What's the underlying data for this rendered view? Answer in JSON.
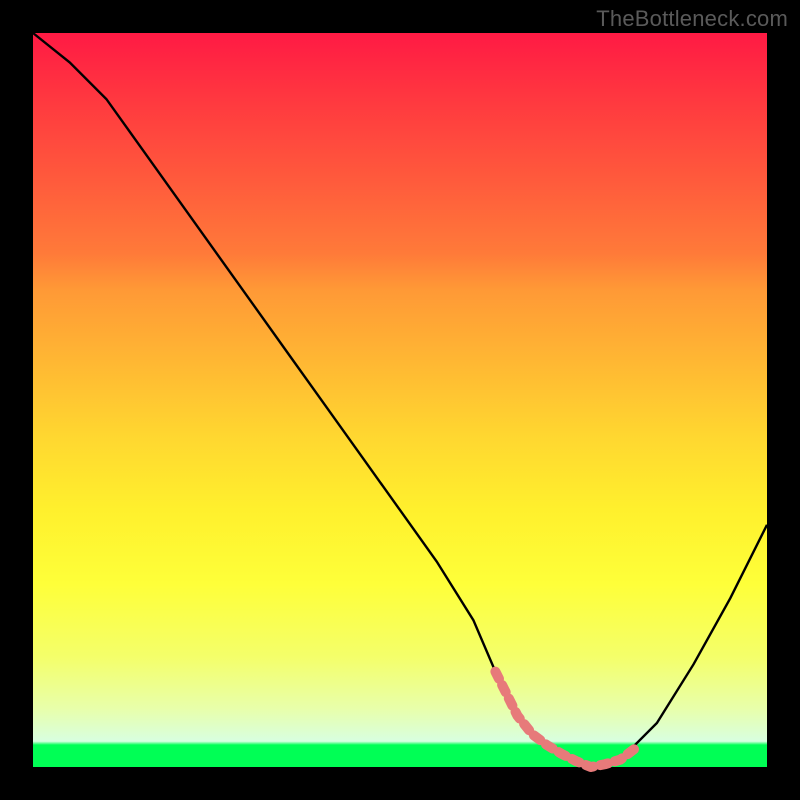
{
  "watermark": "TheBottleneck.com",
  "chart_data": {
    "type": "line",
    "title": "",
    "xlabel": "",
    "ylabel": "",
    "ylim": [
      0,
      100
    ],
    "x": [
      0,
      5,
      10,
      15,
      20,
      25,
      30,
      35,
      40,
      45,
      50,
      55,
      60,
      63,
      66,
      70,
      73,
      76,
      80,
      85,
      90,
      95,
      100
    ],
    "series": [
      {
        "name": "bottleneck-curve",
        "values": [
          100,
          96,
          91,
          84,
          77,
          70,
          63,
          56,
          49,
          42,
          35,
          28,
          20,
          13,
          7,
          3,
          1,
          0,
          1,
          6,
          14,
          23,
          33
        ]
      }
    ],
    "highlight": {
      "name": "optimal-zone",
      "x": [
        63,
        66,
        68,
        70,
        72,
        74,
        76,
        78,
        80,
        82
      ],
      "values": [
        13,
        7,
        4.5,
        3,
        1.8,
        0.8,
        0,
        0.4,
        1,
        2.5
      ],
      "color": "#e77a7a"
    },
    "gradient_stops": [
      {
        "pos": 0,
        "color": "#ff1a44"
      },
      {
        "pos": 50,
        "color": "#ffd730"
      },
      {
        "pos": 80,
        "color": "#feff39"
      },
      {
        "pos": 97,
        "color": "#d8ffe0"
      },
      {
        "pos": 100,
        "color": "#00ff55"
      }
    ]
  }
}
